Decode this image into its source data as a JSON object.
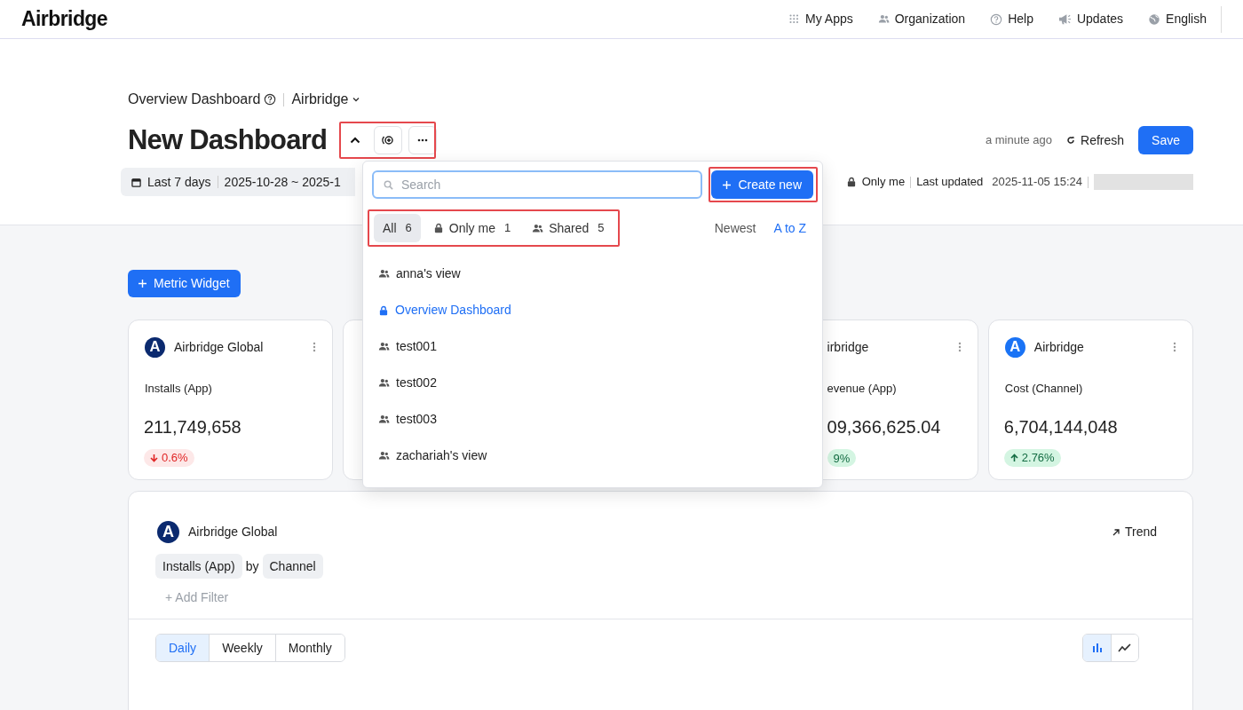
{
  "topbar": {
    "brand": "Airbridge",
    "nav": [
      {
        "label": "My Apps"
      },
      {
        "label": "Organization"
      },
      {
        "label": "Help"
      },
      {
        "label": "Updates"
      },
      {
        "label": "English"
      }
    ]
  },
  "header": {
    "breadcrumb": "Overview Dashboard",
    "app": "Airbridge",
    "title": "New Dashboard",
    "saved_ago": "a minute ago",
    "refresh": "Refresh",
    "save": "Save",
    "date_preset": "Last 7 days",
    "date_range": "2025-10-28 ~ 2025-1",
    "visibility": "Only me",
    "last_updated_label": "Last updated",
    "last_updated": "2025-11-05 15:24"
  },
  "dropdown": {
    "search": {
      "placeholder": "Search"
    },
    "create": "Create new",
    "filters": [
      {
        "label": "All",
        "count": "6",
        "selected": true
      },
      {
        "label": "Only me",
        "count": "1",
        "selected": false
      },
      {
        "label": "Shared",
        "count": "5",
        "selected": false
      }
    ],
    "sorts": [
      {
        "label": "Newest",
        "selected": false
      },
      {
        "label": "A to Z",
        "selected": true
      }
    ],
    "items": [
      {
        "label": "anna's view",
        "kind": "shared",
        "selected": false
      },
      {
        "label": "Overview Dashboard",
        "kind": "private",
        "selected": true
      },
      {
        "label": "test001",
        "kind": "shared",
        "selected": false
      },
      {
        "label": "test002",
        "kind": "shared",
        "selected": false
      },
      {
        "label": "test003",
        "kind": "shared",
        "selected": false
      },
      {
        "label": "zachariah's view",
        "kind": "shared",
        "selected": false
      }
    ]
  },
  "add_widget": "Metric Widget",
  "cards": [
    {
      "kind": "full",
      "logo": "A",
      "color": "#0b2a6f",
      "app": "Airbridge Global",
      "metric": "Installs (App)",
      "value": "211,749,658",
      "delta": "0.6%",
      "rising": false
    },
    {
      "kind": "hidden"
    },
    {
      "kind": "partial",
      "app": "irbridge",
      "metric": "evenue (App)",
      "value": "09,366,625.04",
      "delta": "9%",
      "rising": true
    },
    {
      "kind": "full",
      "logo": "A",
      "color": "#1a73f5",
      "app": "Airbridge",
      "metric": "Cost (Channel)",
      "value": "6,704,144,048",
      "delta": "2.76%",
      "rising": true
    }
  ],
  "panel": {
    "logo": "A",
    "app": "Airbridge Global",
    "trend": "Trend",
    "metric": "Installs (App)",
    "by": "by",
    "dimension": "Channel",
    "add_filter": "+ Add Filter",
    "periods": [
      {
        "label": "Daily",
        "selected": true
      },
      {
        "label": "Weekly",
        "selected": false
      },
      {
        "label": "Monthly",
        "selected": false
      }
    ],
    "chart_types": [
      {
        "kind": "bar",
        "selected": true
      },
      {
        "kind": "line",
        "selected": false
      }
    ]
  }
}
